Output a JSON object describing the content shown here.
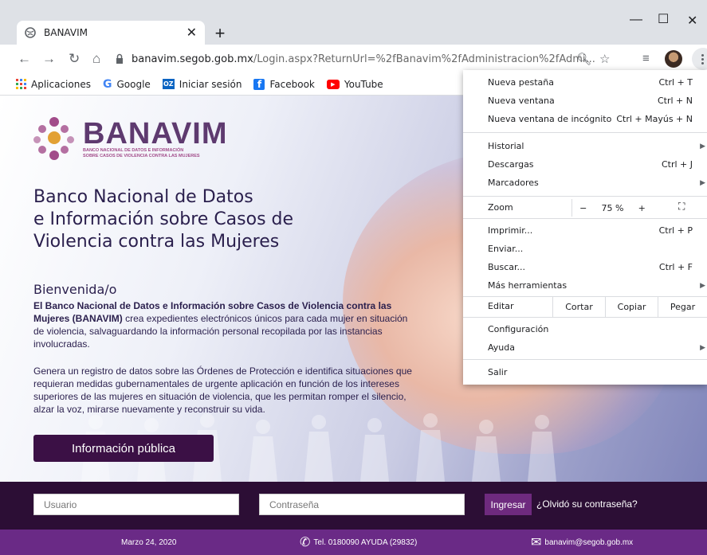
{
  "browser": {
    "tab_title": "BANAVIM",
    "url_host": "banavim.segob.gob.mx",
    "url_path": "/Login.aspx?ReturnUrl=%2fBanavim%2fAdministracion%2fAdmi...",
    "bookmarks": [
      {
        "label": "Aplicaciones",
        "icon": "apps-grid-icon"
      },
      {
        "label": "Google",
        "icon": "google-icon"
      },
      {
        "label": "Iniciar sesión",
        "icon": "outlook-icon"
      },
      {
        "label": "Facebook",
        "icon": "facebook-icon"
      },
      {
        "label": "YouTube",
        "icon": "youtube-icon"
      }
    ]
  },
  "menu": {
    "items": [
      {
        "label": "Nueva pestaña",
        "shortcut": "Ctrl + T"
      },
      {
        "label": "Nueva ventana",
        "shortcut": "Ctrl + N"
      },
      {
        "label": "Nueva ventana de incógnito",
        "shortcut": "Ctrl + Mayús + N"
      },
      {
        "label": "Historial",
        "shortcut": ""
      },
      {
        "label": "Descargas",
        "shortcut": "Ctrl + J"
      },
      {
        "label": "Marcadores",
        "shortcut": ""
      },
      {
        "label": "Imprimir...",
        "shortcut": "Ctrl + P"
      },
      {
        "label": "Enviar...",
        "shortcut": ""
      },
      {
        "label": "Buscar...",
        "shortcut": "Ctrl + F"
      },
      {
        "label": "Más herramientas",
        "shortcut": ""
      },
      {
        "label": "Configuración",
        "shortcut": ""
      },
      {
        "label": "Ayuda",
        "shortcut": ""
      },
      {
        "label": "Salir",
        "shortcut": ""
      }
    ],
    "zoom_label": "Zoom",
    "zoom_minus": "−",
    "zoom_value": "75 %",
    "zoom_plus": "+",
    "edit_label": "Editar",
    "cut": "Cortar",
    "copy": "Copiar",
    "paste": "Pegar"
  },
  "page": {
    "logo_name": "BANAVIM",
    "logo_tag_1": "BANCO NACIONAL DE DATOS E INFORMACIÓN",
    "logo_tag_2": "SOBRE CASOS DE VIOLENCIA CONTRA LAS MUJERES",
    "headline_1": "Banco Nacional de Datos",
    "headline_2": "e Información sobre Casos de",
    "headline_3": "Violencia contra las Mujeres",
    "welcome": "Bienvenida/o",
    "para1_bold": "El Banco Nacional de Datos e Información sobre Casos de Violencia contra las Mujeres (BANAVIM)",
    "para1_rest": " crea expedientes electrónicos únicos para cada mujer en situación de violencia, salvaguardando la información personal recopilada por las instancias involucradas.",
    "para2": "Genera un registro de datos sobre las Órdenes de Protección e identifica situaciones que requieran medidas gubernamentales de urgente aplicación en función de los intereses superiores de las mujeres en situación de violencia, que les permitan romper el silencio, alzar la voz, mirarse nuevamente y reconstruir su vida.",
    "info_button": "Información pública",
    "user_placeholder": "Usuario",
    "pass_placeholder": "Contraseña",
    "login_button": "Ingresar",
    "forgot": "¿Olvidó su contraseña?",
    "footer_date": "Marzo 24, 2020",
    "footer_tel": "Tel. 0180090 AYUDA (29832)",
    "footer_mail": "banavim@segob.gob.mx"
  },
  "colors": {
    "brand_dark": "#2c0e35",
    "brand_purple": "#6a2a86",
    "button": "#3b1045",
    "accent": "#a24c8a"
  }
}
